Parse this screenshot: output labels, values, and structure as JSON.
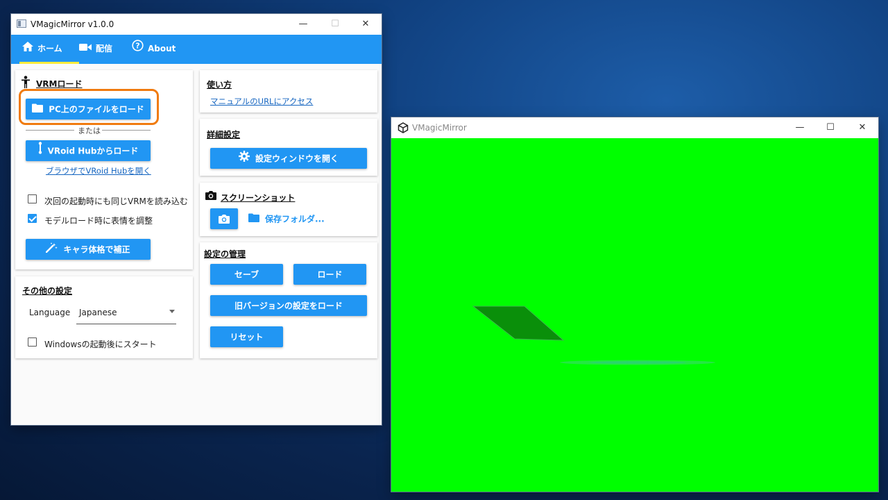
{
  "main_window": {
    "title": "VMagicMirror v1.0.0",
    "controls": {
      "minimize": "—",
      "maximize": "☐",
      "close": "✕"
    },
    "tabs": [
      {
        "label": "ホーム",
        "icon": "home-icon",
        "active": true
      },
      {
        "label": "配信",
        "icon": "video-camera-icon",
        "active": false
      },
      {
        "label": "About",
        "icon": "help-circle-icon",
        "active": false
      }
    ],
    "vrm_load": {
      "title": "VRMロード",
      "load_pc_button": "PC上のファイルをロード",
      "or_text": "または",
      "vroid_button": "VRoid Hubからロード",
      "browser_link": "ブラウザでVRoid Hubを開く",
      "check_same_vrm": {
        "label": "次回の起動時にも同じVRMを読み込む",
        "checked": false
      },
      "check_adjust_face": {
        "label": "モデルロード時に表情を調整",
        "checked": true
      },
      "calibrate_button": "キャラ体格で補正"
    },
    "other_settings": {
      "title": "その他の設定",
      "language_label": "Language",
      "language_value": "Japanese",
      "check_startup": {
        "label": "Windowsの起動後にスタート",
        "checked": false
      }
    },
    "howto": {
      "title": "使い方",
      "manual_link": "マニュアルのURLにアクセス"
    },
    "advanced": {
      "title": "詳細設定",
      "open_button": "設定ウィンドウを開く"
    },
    "screenshot": {
      "title": "スクリーンショット",
      "folder_button": "保存フォルダ..."
    },
    "settings_mgmt": {
      "title": "設定の管理",
      "save_button": "セーブ",
      "load_button": "ロード",
      "load_old_button": "旧バージョンの設定をロード",
      "reset_button": "リセット"
    }
  },
  "unity_window": {
    "title": "VMagicMirror",
    "background_color": "#00ff00"
  },
  "colors": {
    "accent": "#2196f3",
    "tab_underline": "#ffeb3b",
    "highlight": "#f07b10"
  }
}
